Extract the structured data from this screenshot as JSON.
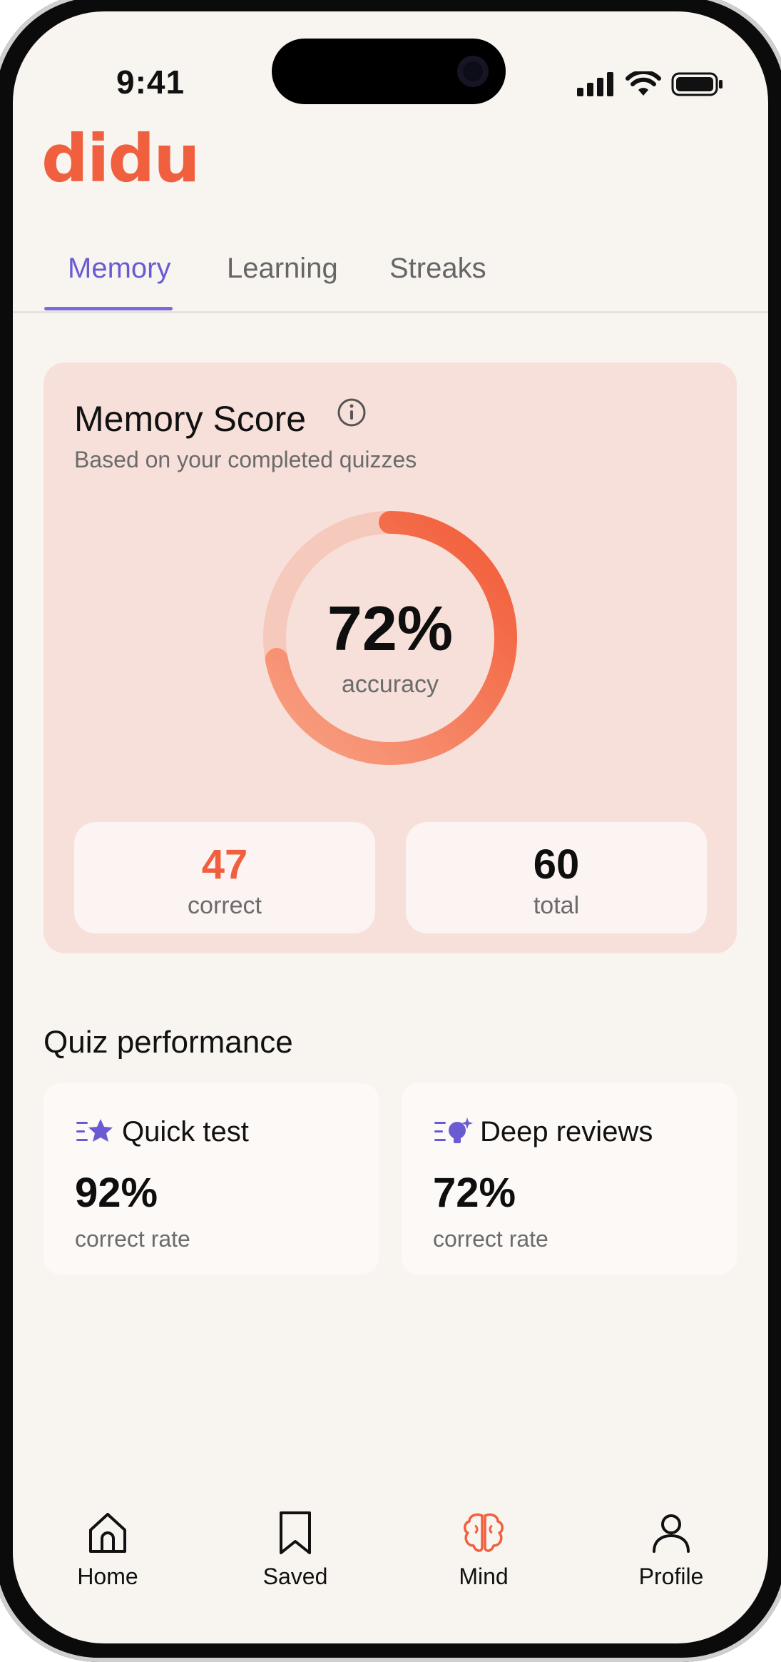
{
  "status": {
    "time": "9:41"
  },
  "logo": {
    "text": "didu"
  },
  "tabs": [
    {
      "label": "Memory",
      "active": true
    },
    {
      "label": "Learning",
      "active": false
    },
    {
      "label": "Streaks",
      "active": false
    }
  ],
  "memory_score": {
    "title": "Memory Score",
    "subtitle": "Based on your completed quizzes",
    "accuracy_value": "72%",
    "accuracy_label": "accuracy",
    "accuracy_fraction": 0.72,
    "correct_value": "47",
    "correct_label": "correct",
    "total_value": "60",
    "total_label": "total"
  },
  "quiz_performance": {
    "title": "Quiz performance",
    "cards": [
      {
        "name": "Quick test",
        "value": "92%",
        "label": "correct rate",
        "icon": "star-list-icon"
      },
      {
        "name": "Deep reviews",
        "value": "72%",
        "label": "correct rate",
        "icon": "bulb-list-icon"
      }
    ]
  },
  "nav": {
    "items": [
      {
        "label": "Home",
        "icon": "home-icon",
        "active": false
      },
      {
        "label": "Saved",
        "icon": "bookmark-icon",
        "active": false
      },
      {
        "label": "Mind",
        "icon": "brain-icon",
        "active": true
      },
      {
        "label": "Profile",
        "icon": "user-icon",
        "active": false
      }
    ]
  },
  "colors": {
    "accent": "#f0603f",
    "tab_active": "#6b5bd2",
    "card_bg": "#f7e0da",
    "page_bg": "#f8f5f1",
    "icon_purple": "#6b5bd2"
  }
}
